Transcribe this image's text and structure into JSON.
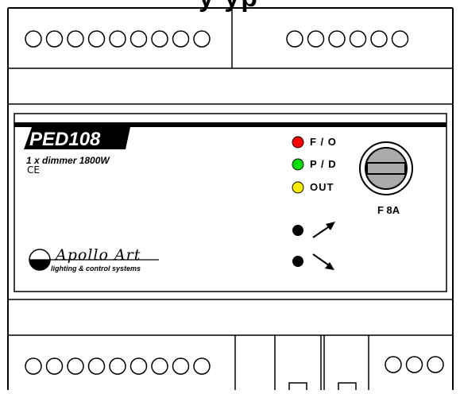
{
  "title_fragment": "y      yp",
  "module": {
    "model_name": "PED108",
    "description": "1 x dimmer 1800W",
    "ce_mark": "CE"
  },
  "indicators": [
    {
      "label": "F / O",
      "color": "#ff0000"
    },
    {
      "label": "P / D",
      "color": "#00dd00"
    },
    {
      "label": "OUT",
      "color": "#ffee00"
    }
  ],
  "fuse": {
    "label": "F 8A"
  },
  "buttons": [
    {
      "icon": "arrow-up-right-icon"
    },
    {
      "icon": "arrow-down-right-icon"
    }
  ],
  "brand": {
    "name": "Apollo Art",
    "tagline": "lighting & control systems"
  },
  "terminals": {
    "top_left_count": 9,
    "top_right_count": 6,
    "bottom_left_count": 9,
    "bottom_right_count": 3
  }
}
